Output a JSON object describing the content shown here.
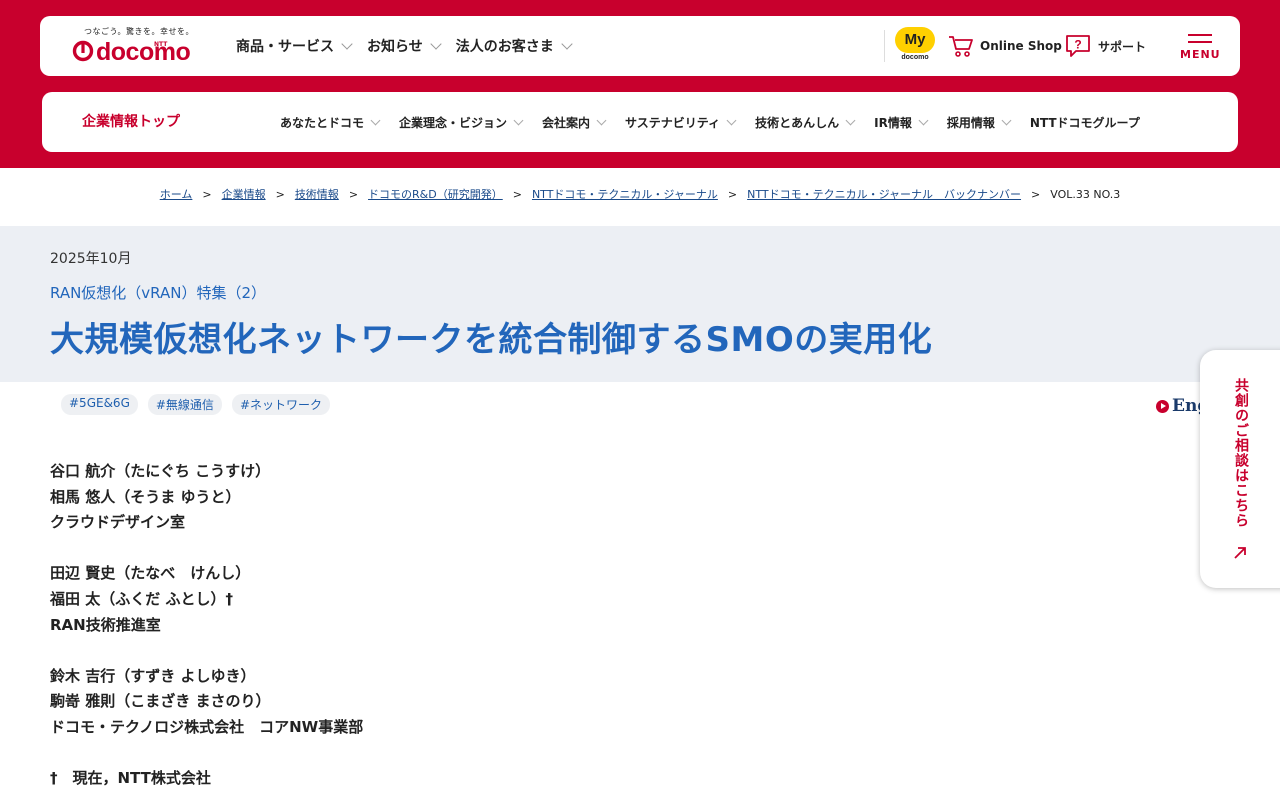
{
  "header": {
    "logo_tagline": "つなごう。驚きを。幸せを。",
    "logo_ntt": "NTT",
    "logo_word": "docomo",
    "nav": [
      {
        "label": "商品・サービス"
      },
      {
        "label": "お知らせ"
      },
      {
        "label": "法人のお客さま"
      }
    ],
    "my_docomo_label": "My",
    "my_docomo_sub": "docomo",
    "online_shop": "Online Shop",
    "support": "サポート",
    "menu": "MENU"
  },
  "subnav": {
    "home": "企業情報トップ",
    "items": [
      {
        "label": "あなたとドコモ"
      },
      {
        "label": "企業理念・ビジョン"
      },
      {
        "label": "会社案内"
      },
      {
        "label": "サステナビリティ"
      },
      {
        "label": "技術とあんしん"
      },
      {
        "label": "IR情報"
      },
      {
        "label": "採用情報"
      },
      {
        "label": "NTTドコモグループ"
      }
    ]
  },
  "breadcrumb": {
    "links": [
      "ホーム",
      "企業情報",
      "技術情報",
      "ドコモのR&D（研究開発）",
      "NTTドコモ・テクニカル・ジャーナル",
      "NTTドコモ・テクニカル・ジャーナル　バックナンバー"
    ],
    "separator": ">",
    "current": "VOL.33 NO.3"
  },
  "article": {
    "date": "2025年10月",
    "series": "RAN仮想化（vRAN）特集（2）",
    "title": "大規模仮想化ネットワークを統合制御するSMOの実用化",
    "tags": [
      "#5GE&6G",
      "#無線通信",
      "#ネットワーク"
    ],
    "english_link": "Eng",
    "authors": [
      "谷口 航介（たにぐち こうすけ）",
      "相馬 悠人（そうま ゆうと）",
      "クラウドデザイン室",
      "",
      "田辺 賢史（たなべ　けんし）",
      "福田 太（ふくだ ふとし）†",
      "RAN技術推進室",
      "",
      "鈴木 吉行（すずき よしゆき）",
      "駒嵜 雅則（こまざき まさのり）",
      "ドコモ・テクノロジ株式会社　コアNW事業部",
      "",
      "†　現在，NTT株式会社"
    ]
  },
  "side_tab": {
    "label": "共創のご相談はこちら"
  },
  "colors": {
    "brand_red": "#c8002d",
    "title_blue": "#2266bb",
    "band_gray": "#eceff4",
    "my_docomo_yellow": "#ffd000"
  }
}
